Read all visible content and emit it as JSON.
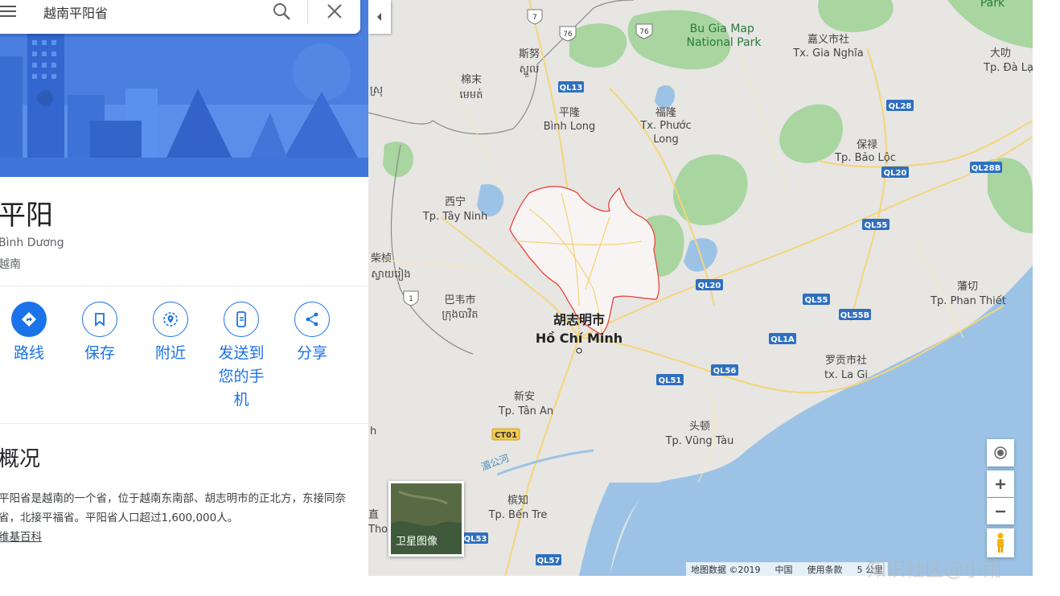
{
  "search": {
    "value": "越南平阳省"
  },
  "place": {
    "title": "平阳",
    "local_name": "Bình Dương",
    "country": "越南"
  },
  "actions": [
    {
      "label": "路线"
    },
    {
      "label": "保存"
    },
    {
      "label": "附近"
    },
    {
      "label": "发送到\n您的手\n机"
    },
    {
      "label": "分享"
    }
  ],
  "overview": {
    "title": "概况",
    "text": "平阳省是越南的一个省，位于越南东南部、胡志明市的正北方，东接同奈省，北接平福省。平阳省人口超过1,600,000人。",
    "source": "维基百科"
  },
  "map": {
    "labels": {
      "park": "Bu Gia Map\nNational Park",
      "park2": "Park",
      "gianghia_cn": "嘉义市社",
      "gianghia": "Tx. Gia Nghĩa",
      "dalat_cn": "大叻",
      "dalat": "Tp. Đà Lạ",
      "snuol_cn": "斯努",
      "snuol": "ស្នួល",
      "memot_cn": "棉末",
      "memot": "មេមត់",
      "srk": "ស្រុ",
      "binhlong_cn": "平隆",
      "binhlong": "Bình Long",
      "phuoclong_cn": "福隆",
      "phuoclong": "Tx. Phước\nLong",
      "baoloc_cn": "保禄",
      "baoloc": "Tp. Bảo Lộc",
      "tayninh_cn": "西宁",
      "tayninh": "Tp. Tây Ninh",
      "svayrieng_cn": "柴桢",
      "svayrieng": "ស្វាយរៀង",
      "bavet_cn": "巴韦市",
      "bavet": "ក្រុងបាវិត",
      "hcm_cn": "胡志明市",
      "hcm": "Hồ Chí Minh",
      "phanthiet_cn": "藩切",
      "phanthiet": "Tp. Phan Thiết",
      "lagi_cn": "罗贡市社",
      "lagi": "tx. La Gi",
      "tanan_cn": "新安",
      "tanan": "Tp. Tân An",
      "vungtau_cn": "头顿",
      "vungtau": "Tp. Vũng Tàu",
      "mekong": "湄公河",
      "bentre_cn": "槟知",
      "bentre": "Tp. Bến Tre",
      "edge_h": "h",
      "edge_tho_cn": "直",
      "edge_tho": "Tho"
    },
    "roads": {
      "r7": "7",
      "r76a": "76",
      "r76b": "76",
      "r1": "1",
      "ql13": "QL13",
      "ql28": "QL28",
      "ql20a": "QL20",
      "ql28b": "QL28B",
      "ql55a": "QL55",
      "ql20b": "QL20",
      "ql55b": "QL55",
      "ql55bb": "QL55B",
      "ql1a": "QL1A",
      "ql51": "QL51",
      "ql56": "QL56",
      "ct01": "CT01",
      "ql53": "QL53",
      "ql57": "QL57"
    },
    "satellite_label": "卫星图像",
    "attribution": {
      "data": "地图数据 ©2019",
      "region": "中国",
      "terms": "使用条款",
      "scale": "5 公里"
    },
    "colors": {
      "land": "#e7e6e3",
      "water": "#9cc3e6",
      "park": "#a8d5a0",
      "highlight_border": "#e8453c",
      "highway": "#f5d57a"
    }
  },
  "watermark": "知识社区@小雨"
}
